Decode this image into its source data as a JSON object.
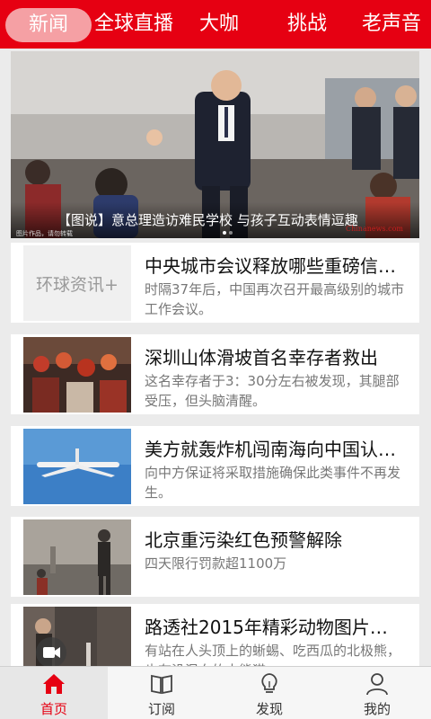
{
  "channels": {
    "tabs": [
      {
        "label": "新闻",
        "active": true
      },
      {
        "label": "全球直播"
      },
      {
        "label": "大咖"
      },
      {
        "label": "挑战"
      },
      {
        "label": "老声音"
      }
    ]
  },
  "banner": {
    "caption": "【图说】意总理造访难民学校 与孩子互动表情逗趣",
    "credit": "图片作品，请勿转载",
    "watermark": "Chinanews.com"
  },
  "news": [
    {
      "thumb_text": "环球资讯+",
      "title": "中央城市会议释放哪些重磅信…",
      "desc": "时隔37年后，中国再次召开最高级别的城市工作会议。"
    },
    {
      "title": "深圳山体滑坡首名幸存者救出",
      "desc": "这名幸存者于3：30分左右被发现，其腿部受压，但头脑清醒。"
    },
    {
      "title": "美方就轰炸机闯南海向中国认…",
      "desc": "向中方保证将采取措施确保此类事件不再发生。"
    },
    {
      "title": "北京重污染红色预警解除",
      "desc": "四天限行罚款超1100万"
    },
    {
      "title": "路透社2015年精彩动物图片…",
      "desc": "有站在人头顶上的蜥蜴、吃西瓜的北极熊，也有没混血的大熊猫"
    }
  ],
  "bottom_nav": [
    {
      "label": "首页",
      "icon": "home-icon",
      "active": true
    },
    {
      "label": "订阅",
      "icon": "book-icon"
    },
    {
      "label": "发现",
      "icon": "lightbulb-icon"
    },
    {
      "label": "我的",
      "icon": "user-icon"
    }
  ],
  "colors": {
    "brand": "#e60012",
    "active_tab_pill": "#f5a0a4",
    "nav_active_text": "#e60012"
  }
}
